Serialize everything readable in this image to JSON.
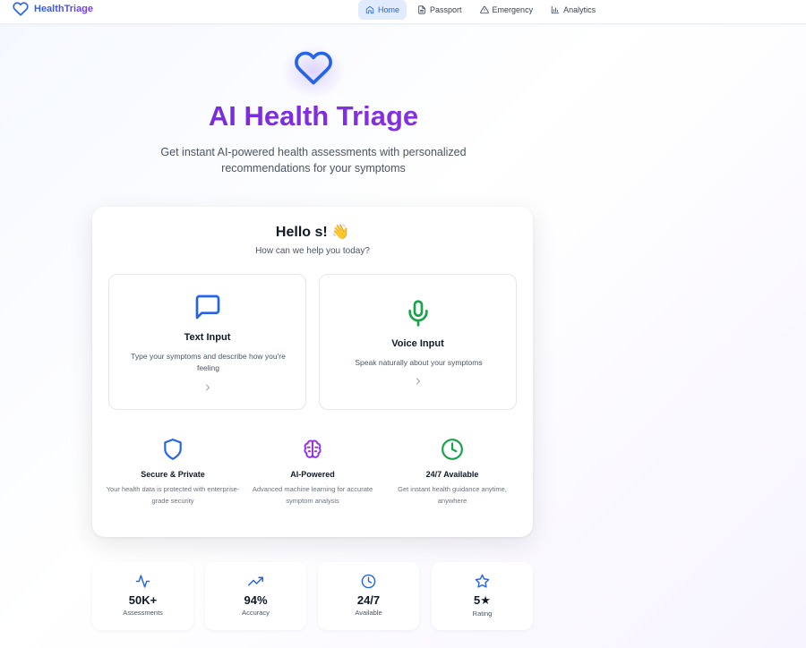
{
  "app": {
    "brand": "HealthTriage",
    "accent": "#2563eb",
    "brand_purple": "#7c3aed"
  },
  "nav": {
    "items": [
      {
        "label": "Home",
        "icon": "home-icon",
        "active": true
      },
      {
        "label": "Passport",
        "icon": "document-icon",
        "active": false
      },
      {
        "label": "Emergency",
        "icon": "alert-triangle-icon",
        "active": false
      },
      {
        "label": "Analytics",
        "icon": "bar-chart-icon",
        "active": false
      }
    ]
  },
  "hero": {
    "icon": "heart-icon",
    "title": "AI Health Triage",
    "subtitle": "Get instant AI-powered health assessments with personalized recommendations for your symptoms"
  },
  "card": {
    "greeting": "Hello s! 👋",
    "greeting_sub": "How can we help you today?",
    "options": [
      {
        "title": "Text Input",
        "desc": "Type your symptoms and describe how you're feeling",
        "icon": "chat-bubble-icon",
        "color": "#2563eb"
      },
      {
        "title": "Voice Input",
        "desc": "Speak naturally about your symptoms",
        "icon": "microphone-icon",
        "color": "#16a34a"
      }
    ],
    "features": [
      {
        "title": "Secure & Private",
        "desc": "Your health data is protected with enterprise-grade security",
        "icon": "shield-icon",
        "color": "#2563eb"
      },
      {
        "title": "AI-Powered",
        "desc": "Advanced machine learning for accurate symptom analysis",
        "icon": "brain-icon",
        "color": "#9333ea"
      },
      {
        "title": "24/7 Available",
        "desc": "Get instant health guidance anytime, anywhere",
        "icon": "clock-icon",
        "color": "#16a34a"
      }
    ]
  },
  "stats": [
    {
      "value": "50K+",
      "label": "Assessments",
      "icon": "activity-icon"
    },
    {
      "value": "94%",
      "label": "Accuracy",
      "icon": "trending-up-icon"
    },
    {
      "value": "24/7",
      "label": "Available",
      "icon": "clock-icon"
    },
    {
      "value": "5★",
      "label": "Rating",
      "icon": "star-icon"
    }
  ]
}
